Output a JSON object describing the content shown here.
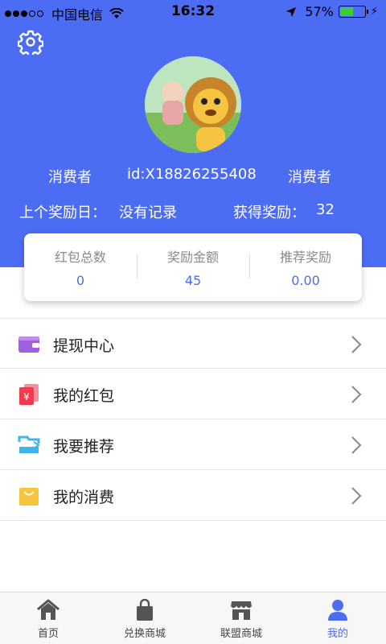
{
  "status_bar": {
    "carrier": "中国电信",
    "time": "16:32",
    "battery": "57%",
    "battery_level": 0.57
  },
  "profile": {
    "role_left": "消费者",
    "user_id": "id:X18826255408",
    "role_right": "消费者",
    "last_reward_label": "上个奖励日：",
    "last_reward_value": "没有记录",
    "earned_label": "获得奖励：",
    "earned_value": "32"
  },
  "stats": [
    {
      "label": "红包总数",
      "value": "0"
    },
    {
      "label": "奖励金额",
      "value": "45"
    },
    {
      "label": "推荐奖励",
      "value": "0.00"
    }
  ],
  "menu": [
    {
      "label": "提现中心",
      "icon": "wallet-icon"
    },
    {
      "label": "我的红包",
      "icon": "red-packet-icon"
    },
    {
      "label": "我要推荐",
      "icon": "share-icon"
    },
    {
      "label": "我的消费",
      "icon": "shopping-bag-icon"
    }
  ],
  "tabs": [
    {
      "label": "首页",
      "icon": "home-icon"
    },
    {
      "label": "兑换商城",
      "icon": "bag-icon"
    },
    {
      "label": "联盟商城",
      "icon": "store-icon"
    },
    {
      "label": "我的",
      "icon": "user-icon"
    }
  ],
  "colors": {
    "primary": "#4d6cf4",
    "battery_green": "#3ecb3a",
    "wallet": "#a25ee0",
    "red_packet": "#f2394e",
    "share": "#3fb6e8",
    "bag": "#f7c53b"
  }
}
